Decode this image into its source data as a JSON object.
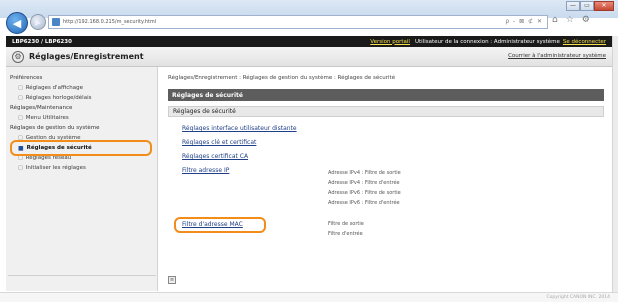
{
  "browser": {
    "url": "http://192.168.0.215/m_security.html",
    "toolbar_glyphs": "ρ - ⊠ ⊄ ✕",
    "tab_glyphs": [
      "⌂",
      "☆",
      "⚙"
    ],
    "window_buttons": [
      "—",
      "▭",
      "✕"
    ]
  },
  "header": {
    "model": "LBP6230 / LBP6230",
    "portal_link": "Version portail",
    "user_label": "Utilisateur de la connexion : Administrateur système",
    "logout_link": "Se déconnecter",
    "page_title": "Réglages/Enregistrement",
    "mail_admin_link": "Courrier à l'administrateur système"
  },
  "sidebar": {
    "sections": [
      {
        "title": "Préférences",
        "items": [
          "Réglages d'affichage",
          "Réglages horloge/délais"
        ]
      },
      {
        "title": "Réglages/Maintenance",
        "items": [
          "Menu Utilitaires"
        ]
      },
      {
        "title": "Réglages de gestion du système",
        "items": [
          "Gestion du système",
          "Réglages de sécurité",
          "Réglages réseau",
          "Initialiser les réglages"
        ]
      }
    ],
    "active_item": "Réglages de sécurité"
  },
  "main": {
    "breadcrumb": "Réglages/Enregistrement : Réglages de gestion du système : Réglages de sécurité",
    "panel_title": "Réglages de sécurité",
    "section_title": "Réglages de sécurité",
    "links": [
      "Réglages interface utilisateur distante",
      "Réglages clé et certificat",
      "Réglages certificat CA",
      "Filtre adresse IP",
      "Filtre d'adresse MAC"
    ],
    "ip_filter_desc": [
      "Adresse IPv4 : Filtre de sortie",
      "Adresse IPv4 : Filtre d'entrée",
      "Adresse IPv6 : Filtre de sortie",
      "Adresse IPv6 : Filtre d'entrée"
    ],
    "mac_filter_desc": [
      "Filtre de sortie",
      "Filtre d'entrée"
    ]
  },
  "footer": {
    "copyright": "Copyright CANON INC. 2014"
  }
}
